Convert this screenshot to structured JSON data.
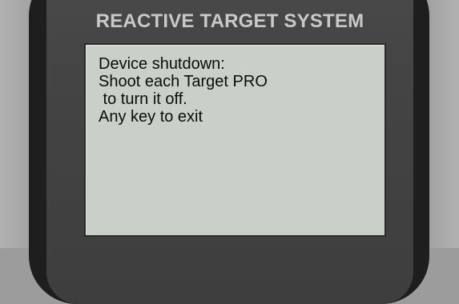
{
  "device": {
    "title": "REACTIVE TARGET SYSTEM"
  },
  "screen": {
    "lines": [
      "Device shutdown:",
      "Shoot each Target PRO",
      " to turn it off.",
      "Any key to exit"
    ]
  },
  "colors": {
    "lcd_background": "#c8d0c8",
    "lcd_text": "#0c0c0c",
    "device_body": "#444444",
    "title_text": "#c9c9c9"
  }
}
